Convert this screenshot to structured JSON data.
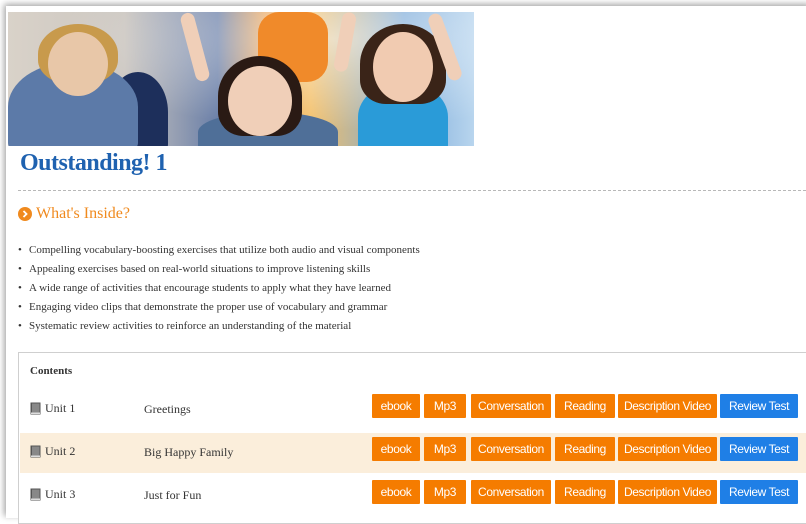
{
  "page": {
    "title": "Outstanding! 1"
  },
  "whats_inside": {
    "heading": "What's Inside?",
    "items": [
      "Compelling vocabulary-boosting exercises that utilize both audio and visual components",
      "Appealing exercises based on real-world situations to improve listening skills",
      "A wide range of activities that encourage students to apply what they have learned",
      "Engaging video clips that demonstrate the proper use of vocabulary and grammar",
      "Systematic review activities to reinforce an understanding of the material"
    ]
  },
  "contents": {
    "heading": "Contents",
    "rows": [
      {
        "unit": "Unit 1",
        "topic": "Greetings",
        "buttons": [
          "ebook",
          "Mp3",
          "Conversation",
          "Reading",
          "Description Video",
          "Review Test"
        ]
      },
      {
        "unit": "Unit 2",
        "topic": "Big Happy Family",
        "buttons": [
          "ebook",
          "Mp3",
          "Conversation",
          "Reading",
          "Description Video",
          "Review Test"
        ]
      },
      {
        "unit": "Unit 3",
        "topic": "Just for Fun",
        "buttons": [
          "ebook",
          "Mp3",
          "Conversation",
          "Reading",
          "Description Video",
          "Review Test"
        ]
      }
    ]
  },
  "colors": {
    "title": "#1f62b0",
    "accent_orange": "#f57c00",
    "review_blue": "#1f7fe6",
    "alt_row": "#fbeedb"
  },
  "icons": {
    "section": "circle-arrow-icon",
    "unit": "book-icon"
  }
}
